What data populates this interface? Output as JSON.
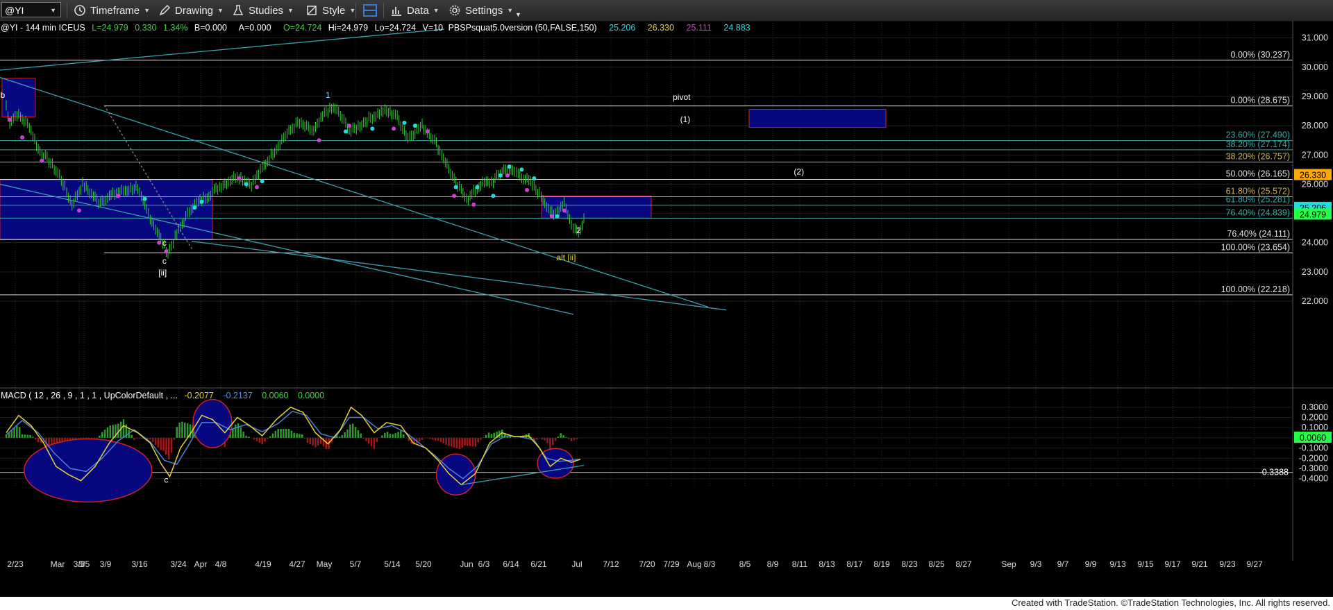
{
  "toolbar": {
    "symbol": "@YI",
    "timeframe_label": "Timeframe",
    "drawing_label": "Drawing",
    "studies_label": "Studies",
    "style_label": "Style",
    "data_label": "Data",
    "settings_label": "Settings"
  },
  "header": {
    "symbol_info": "@YI - 144 min  ICEUS",
    "last": "L=24.979",
    "change": "0.330",
    "change_pct": "1.34%",
    "b": "B=0.000",
    "a": "A=0.000",
    "open": "O=24.724",
    "high": "Hi=24.979",
    "low": "Lo=24.724",
    "volume": "V=10",
    "study_name": "PBSPsquat5.0version (50,FALSE,150)",
    "study_values": [
      "25.206",
      "26.330",
      "25.111",
      "24.883"
    ]
  },
  "macd_header": {
    "label": "MACD ( 12 , 26 , 9 , 1 , 1 , UpColorDefault , ...",
    "values": [
      "-0.2077",
      "-0.2137",
      "0.0060",
      "0.0000"
    ]
  },
  "footer_text": "Created with TradeStation. ©TradeStation Technologies, Inc. All rights reserved.",
  "colors": {
    "background": "#000000",
    "price_bars": "#33cc33",
    "macd_line": "#e8d23a",
    "signal_line": "#4f7fd6",
    "hist_up": "#2e9b2e",
    "hist_down": "#a01818",
    "box_fill": "#07077f",
    "box_edge": "#cc2222",
    "trend": "#3aa0b0",
    "fib_white": "#e0e0e0",
    "fib_teal": "#3aa8a8",
    "fib_olive": "#c8b45a",
    "axis_label_orange": "#ffaa00",
    "axis_label_green": "#22ff44",
    "axis_label_teal": "#22dddd"
  },
  "chart_data": [
    {
      "type": "line",
      "panel": "price",
      "symbol": "@YI",
      "ylim": [
        21.55,
        31.3
      ],
      "y_ticks": [
        "31.000",
        "30.000",
        "29.000",
        "28.000",
        "27.000",
        "26.000",
        "25.000",
        "24.000",
        "23.000",
        "22.000"
      ],
      "x_ticks": [
        "2/23",
        "Mar",
        "3/3",
        "3/5",
        "3/9",
        "3/16",
        "3/24",
        "Apr",
        "4/8",
        "4/19",
        "4/27",
        "May",
        "5/7",
        "5/14",
        "5/20",
        "Jun",
        "6/3",
        "6/14",
        "6/21",
        "Jul",
        "7/12",
        "7/20",
        "7/29",
        "Aug",
        "8/3",
        "8/5",
        "8/9",
        "8/11",
        "8/13",
        "8/17",
        "8/19",
        "8/23",
        "8/25",
        "8/27",
        "Sep",
        "9/3",
        "9/7",
        "9/9",
        "9/13",
        "9/15",
        "9/17",
        "9/21",
        "9/23",
        "9/27"
      ],
      "price_path": [
        [
          0,
          28.7
        ],
        [
          0.15,
          28.1
        ],
        [
          0.6,
          28.4
        ],
        [
          1.3,
          28.0
        ],
        [
          1.8,
          27.2
        ],
        [
          2.4,
          26.8
        ],
        [
          3.0,
          26.3
        ],
        [
          3.7,
          25.3
        ],
        [
          4.3,
          26.0
        ],
        [
          5.2,
          25.4
        ],
        [
          6.2,
          25.7
        ],
        [
          7.3,
          25.9
        ],
        [
          8.0,
          25.0
        ],
        [
          8.8,
          24.0
        ],
        [
          9.1,
          23.65
        ],
        [
          9.6,
          24.3
        ],
        [
          10.4,
          25.2
        ],
        [
          11.3,
          25.6
        ],
        [
          12.2,
          26.0
        ],
        [
          13.0,
          26.3
        ],
        [
          13.8,
          26.0
        ],
        [
          14.7,
          26.8
        ],
        [
          15.6,
          27.6
        ],
        [
          16.4,
          28.1
        ],
        [
          17.3,
          27.8
        ],
        [
          18.0,
          28.5
        ],
        [
          18.5,
          28.6
        ],
        [
          19.4,
          27.8
        ],
        [
          20.3,
          28.2
        ],
        [
          21.2,
          28.5
        ],
        [
          21.9,
          28.4
        ],
        [
          22.6,
          27.6
        ],
        [
          23.4,
          28.0
        ],
        [
          24.0,
          27.6
        ],
        [
          24.7,
          26.8
        ],
        [
          25.3,
          26.0
        ],
        [
          26.0,
          25.5
        ],
        [
          26.7,
          26.0
        ],
        [
          27.4,
          26.1
        ],
        [
          28.0,
          26.5
        ],
        [
          28.7,
          26.4
        ],
        [
          29.4,
          26.1
        ],
        [
          30.1,
          25.6
        ],
        [
          30.8,
          24.9
        ],
        [
          31.4,
          25.4
        ],
        [
          31.8,
          24.6
        ],
        [
          32.2,
          24.35
        ],
        [
          32.6,
          25.0
        ]
      ],
      "magenta_dots": [
        [
          0.2,
          28.2
        ],
        [
          0.9,
          27.6
        ],
        [
          2.0,
          26.8
        ],
        [
          4.1,
          25.1
        ],
        [
          6.3,
          25.6
        ],
        [
          8.6,
          24.0
        ],
        [
          9.0,
          23.7
        ],
        [
          13.1,
          26.2
        ],
        [
          14.1,
          25.9
        ],
        [
          17.6,
          27.5
        ],
        [
          19.3,
          28.0
        ],
        [
          21.8,
          27.9
        ],
        [
          23.7,
          27.8
        ],
        [
          25.2,
          25.6
        ],
        [
          26.3,
          25.3
        ],
        [
          28.2,
          26.3
        ],
        [
          29.3,
          25.8
        ],
        [
          30.7,
          24.9
        ],
        [
          31.4,
          25.1
        ]
      ],
      "cyan_dots": [
        [
          7.8,
          25.5
        ],
        [
          10.6,
          25.2
        ],
        [
          11.0,
          25.4
        ],
        [
          13.5,
          26.0
        ],
        [
          14.4,
          26.1
        ],
        [
          19.1,
          27.8
        ],
        [
          20.6,
          27.9
        ],
        [
          22.4,
          28.1
        ],
        [
          23.0,
          28.0
        ],
        [
          25.3,
          25.9
        ],
        [
          26.5,
          25.9
        ],
        [
          27.4,
          25.6
        ],
        [
          27.8,
          26.3
        ],
        [
          28.3,
          26.6
        ],
        [
          29.0,
          26.5
        ],
        [
          29.7,
          26.2
        ],
        [
          31.0,
          24.9
        ]
      ],
      "fib_levels": [
        {
          "label": "0.00% (30.237)",
          "value": 30.237,
          "color": "white"
        },
        {
          "label": "0.00% (28.675)",
          "value": 28.675,
          "color": "white"
        },
        {
          "label": "23.60% (27.490)",
          "value": 27.49,
          "color": "teal"
        },
        {
          "label": "38.20% (27.174)",
          "value": 27.174,
          "color": "teal"
        },
        {
          "label": "38.20% (26.757)",
          "value": 26.757,
          "color": "olive"
        },
        {
          "label": "50.00% (26.165)",
          "value": 26.165,
          "color": "white"
        },
        {
          "label": "61.80% (25.572)",
          "value": 25.572,
          "color": "olive"
        },
        {
          "label": "61.80% (25.281)",
          "value": 25.281,
          "color": "teal"
        },
        {
          "label": "76.40% (24.839)",
          "value": 24.839,
          "color": "teal"
        },
        {
          "label": "76.40% (24.111)",
          "value": 24.111,
          "color": "white"
        },
        {
          "label": "100.00% (23.654)",
          "value": 23.654,
          "color": "white"
        },
        {
          "label": "100.00% (22.218)",
          "value": 22.218,
          "color": "white"
        }
      ],
      "axis_tags": [
        {
          "label": "26.330",
          "value": 26.33,
          "color": "orange"
        },
        {
          "label": "25.206",
          "value": 25.206,
          "color": "teal"
        },
        {
          "label": "24.979",
          "value": 24.979,
          "color": "green"
        }
      ],
      "annotations": [
        {
          "text": "b",
          "x": -0.2,
          "y": 28.95,
          "color": "white"
        },
        {
          "text": "1",
          "x": 18.1,
          "y": 28.95,
          "color": "cyan"
        },
        {
          "text": "pivot",
          "x": 38.0,
          "y": 28.88,
          "color": "white"
        },
        {
          "text": "(1)",
          "x": 38.2,
          "y": 28.12,
          "color": "white"
        },
        {
          "text": "(2)",
          "x": 44.6,
          "y": 26.33,
          "color": "white"
        },
        {
          "text": "2",
          "x": 32.2,
          "y": 24.32,
          "color": "white"
        },
        {
          "text": "c",
          "x": 8.9,
          "y": 23.9,
          "color": "white"
        },
        {
          "text": "c",
          "x": 8.9,
          "y": 23.28,
          "color": "white"
        },
        {
          "text": "[ii]",
          "x": 8.8,
          "y": 22.88,
          "color": "white"
        },
        {
          "text": "alt [ii]",
          "x": 31.5,
          "y": 23.4,
          "color": "yellow"
        }
      ]
    },
    {
      "type": "area",
      "panel": "macd",
      "name": "MACD ( 12 , 26 , 9 , 1 , 1 , UpColorDefault , ...",
      "ylim": [
        -0.47,
        0.36
      ],
      "y_ticks": [
        "0.3000",
        "0.2000",
        "0.1000",
        "0.0000",
        "-0.1000",
        "-0.2000",
        "-0.3000",
        "-0.4000"
      ],
      "axis_tag": {
        "label": "0.0060",
        "value": 0.006
      },
      "horizontal_level": {
        "label": "-0.3388",
        "value": -0.3388
      },
      "macd_path": [
        [
          0,
          0.05
        ],
        [
          0.7,
          0.22
        ],
        [
          1.4,
          0.12
        ],
        [
          2.1,
          -0.05
        ],
        [
          2.8,
          -0.28
        ],
        [
          3.5,
          -0.36
        ],
        [
          4.2,
          -0.42
        ],
        [
          5.0,
          -0.28
        ],
        [
          5.8,
          -0.05
        ],
        [
          6.6,
          0.12
        ],
        [
          7.4,
          0.05
        ],
        [
          8.1,
          -0.05
        ],
        [
          8.7,
          -0.25
        ],
        [
          9.2,
          -0.38
        ],
        [
          9.8,
          -0.1
        ],
        [
          10.4,
          0.05
        ],
        [
          11.0,
          0.22
        ],
        [
          11.6,
          0.18
        ],
        [
          12.3,
          0.05
        ],
        [
          13.0,
          0.2
        ],
        [
          13.7,
          0.12
        ],
        [
          14.4,
          0.02
        ],
        [
          15.2,
          0.18
        ],
        [
          16.0,
          0.3
        ],
        [
          16.7,
          0.25
        ],
        [
          17.4,
          0.05
        ],
        [
          18.1,
          -0.06
        ],
        [
          18.8,
          0.08
        ],
        [
          19.4,
          0.3
        ],
        [
          20.0,
          0.22
        ],
        [
          20.7,
          0.05
        ],
        [
          21.4,
          0.15
        ],
        [
          22.2,
          0.12
        ],
        [
          22.9,
          -0.05
        ],
        [
          23.6,
          -0.1
        ],
        [
          24.3,
          -0.22
        ],
        [
          24.9,
          -0.35
        ],
        [
          25.6,
          -0.46
        ],
        [
          26.4,
          -0.35
        ],
        [
          27.2,
          -0.05
        ],
        [
          27.9,
          0.05
        ],
        [
          28.6,
          0.01
        ],
        [
          29.4,
          0.02
        ],
        [
          30.0,
          -0.1
        ],
        [
          30.6,
          -0.28
        ],
        [
          31.2,
          -0.2
        ],
        [
          31.8,
          -0.24
        ],
        [
          32.3,
          -0.21
        ]
      ],
      "signal_path": [
        [
          0,
          0.03
        ],
        [
          0.9,
          0.17
        ],
        [
          1.8,
          0.05
        ],
        [
          2.7,
          -0.15
        ],
        [
          3.6,
          -0.3
        ],
        [
          4.5,
          -0.33
        ],
        [
          5.4,
          -0.2
        ],
        [
          6.3,
          -0.03
        ],
        [
          7.2,
          0.08
        ],
        [
          8.1,
          -0.04
        ],
        [
          8.9,
          -0.22
        ],
        [
          9.6,
          -0.26
        ],
        [
          10.3,
          -0.06
        ],
        [
          11.0,
          0.15
        ],
        [
          11.8,
          0.15
        ],
        [
          12.6,
          0.08
        ],
        [
          13.5,
          0.13
        ],
        [
          14.4,
          0.06
        ],
        [
          15.3,
          0.14
        ],
        [
          16.1,
          0.26
        ],
        [
          16.9,
          0.22
        ],
        [
          17.7,
          0.04
        ],
        [
          18.5,
          0.0
        ],
        [
          19.3,
          0.2
        ],
        [
          20.1,
          0.2
        ],
        [
          20.9,
          0.09
        ],
        [
          21.7,
          0.12
        ],
        [
          22.5,
          0.05
        ],
        [
          23.3,
          -0.06
        ],
        [
          24.1,
          -0.17
        ],
        [
          24.9,
          -0.3
        ],
        [
          25.7,
          -0.4
        ],
        [
          26.5,
          -0.28
        ],
        [
          27.3,
          -0.06
        ],
        [
          28.1,
          0.02
        ],
        [
          28.9,
          0.01
        ],
        [
          29.7,
          -0.02
        ],
        [
          30.4,
          -0.2
        ],
        [
          31.1,
          -0.23
        ],
        [
          31.8,
          -0.22
        ],
        [
          32.3,
          -0.21
        ]
      ],
      "annotations": [
        {
          "text": "c",
          "x": 9.0,
          "y": -0.44,
          "color": "white"
        }
      ]
    }
  ]
}
